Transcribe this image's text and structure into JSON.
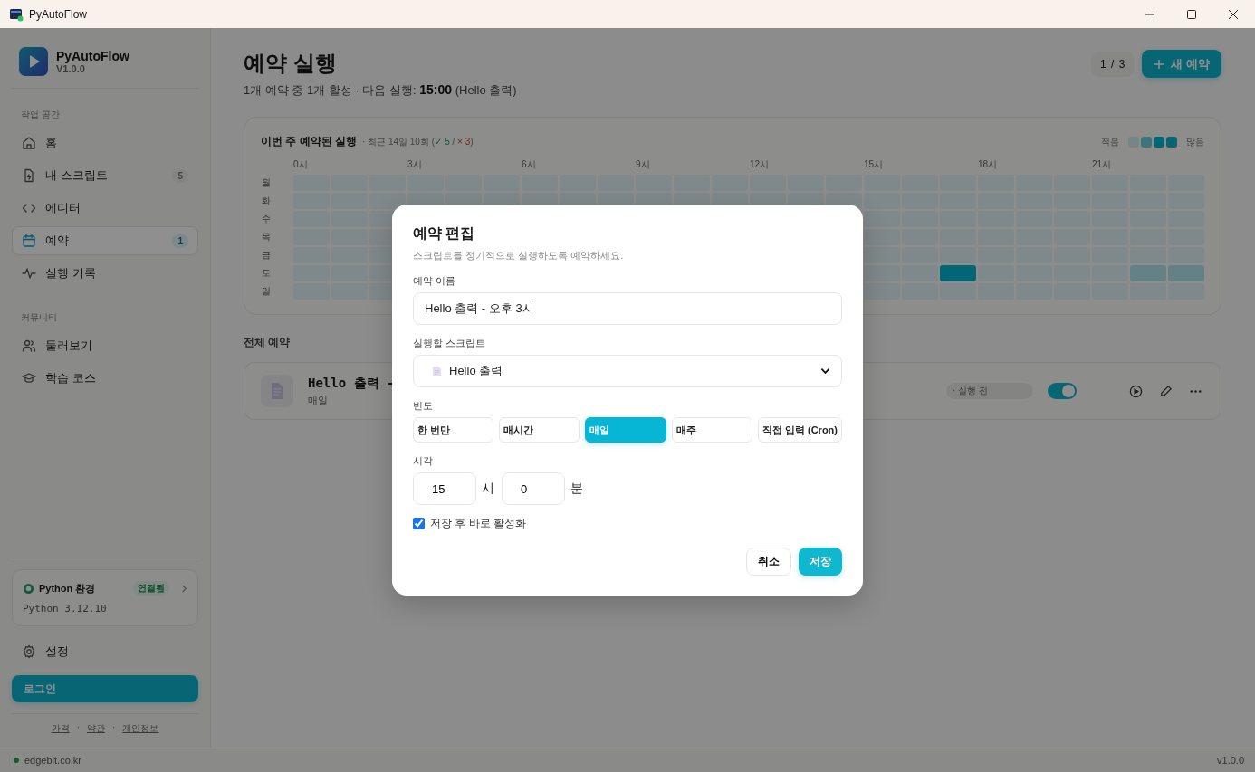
{
  "window": {
    "title": "PyAutoFlow"
  },
  "sidebar": {
    "app_name": "PyAutoFlow",
    "version": "V1.0.0",
    "sections": [
      {
        "title": "작업 공간",
        "items": [
          {
            "label": "홈",
            "selected": false
          },
          {
            "label": "내 스크립트",
            "badge": "5",
            "selected": false
          },
          {
            "label": "에디터",
            "selected": false
          },
          {
            "label": "예약",
            "badge": "1",
            "selected": true
          },
          {
            "label": "실행 기록",
            "selected": false
          }
        ]
      },
      {
        "title": "커뮤니티",
        "items": [
          {
            "label": "둘러보기",
            "selected": false
          },
          {
            "label": "학습 코스",
            "selected": false
          }
        ]
      }
    ],
    "python": {
      "title": "Python 환경",
      "status": "연결됨",
      "version": "Python 3.12.10"
    },
    "settings": "설정",
    "login": "로그인",
    "footer_links": {
      "separator": "·",
      "items": [
        "가격",
        "약관",
        "개인정보"
      ]
    }
  },
  "header": {
    "title": "예약 실행",
    "subtitle": "1개 예약 중 1개 활성 · 다음 실행: **15:00** (Hello 출력)",
    "pager": "1 / 3",
    "new_button": "새 예약"
  },
  "heatmap": {
    "title": "이번 주 예약된 실행",
    "summary": {
      "prefix": "· 최근 14일 10회 (",
      "success": "✓ 5",
      "separator": " / ",
      "failure": "× 3",
      "suffix": ")"
    },
    "legend": {
      "low": "적음",
      "high": "많음"
    },
    "hour_labels": [
      "0시",
      "3시",
      "6시",
      "9시",
      "12시",
      "15시",
      "18시",
      "21시"
    ],
    "rows": [
      {
        "day": "월",
        "cells": [
          {
            "kind": "none"
          },
          {
            "kind": "none"
          },
          {
            "kind": "none"
          },
          {
            "kind": "none"
          },
          {
            "kind": "none"
          },
          {
            "kind": "none"
          },
          {
            "kind": "none"
          },
          {
            "kind": "none"
          },
          {
            "kind": "none"
          },
          {
            "kind": "none"
          },
          {
            "kind": "none"
          },
          {
            "kind": "none"
          },
          {
            "kind": "none"
          },
          {
            "kind": "none"
          },
          {
            "kind": "none"
          },
          {
            "kind": "none"
          },
          {
            "kind": "none"
          },
          {
            "kind": "none"
          },
          {
            "kind": "none"
          },
          {
            "kind": "none"
          },
          {
            "kind": "none"
          },
          {
            "kind": "none"
          },
          {
            "kind": "none"
          },
          {
            "kind": "none"
          }
        ]
      },
      {
        "day": "화",
        "cells": [
          {
            "kind": "none"
          },
          {
            "kind": "none"
          },
          {
            "kind": "none"
          },
          {
            "kind": "none"
          },
          {
            "kind": "none"
          },
          {
            "kind": "none"
          },
          {
            "kind": "none"
          },
          {
            "kind": "none"
          },
          {
            "kind": "none"
          },
          {
            "kind": "none"
          },
          {
            "kind": "none"
          },
          {
            "kind": "none"
          },
          {
            "kind": "none"
          },
          {
            "kind": "none"
          },
          {
            "kind": "none"
          },
          {
            "kind": "none"
          },
          {
            "kind": "none"
          },
          {
            "kind": "none"
          },
          {
            "kind": "none"
          },
          {
            "kind": "none"
          },
          {
            "kind": "none"
          },
          {
            "kind": "none"
          },
          {
            "kind": "none"
          },
          {
            "kind": "none"
          }
        ]
      },
      {
        "day": "수",
        "cells": [
          {
            "kind": "none"
          },
          {
            "kind": "none"
          },
          {
            "kind": "none"
          },
          null,
          null,
          null,
          null,
          null,
          null,
          null,
          null,
          null,
          null,
          null,
          null,
          {
            "kind": "none"
          },
          {
            "kind": "none"
          },
          {
            "kind": "none"
          },
          {
            "kind": "none"
          },
          {
            "kind": "none"
          },
          {
            "kind": "none"
          },
          {
            "kind": "none"
          },
          {
            "kind": "none"
          },
          {
            "kind": "none"
          }
        ]
      },
      {
        "day": "목",
        "cells": [
          {
            "kind": "none"
          },
          {
            "kind": "none"
          },
          {
            "kind": "none"
          },
          null,
          null,
          null,
          null,
          null,
          null,
          null,
          null,
          null,
          null,
          null,
          null,
          {
            "kind": "none"
          },
          {
            "kind": "none"
          },
          {
            "kind": "none"
          },
          {
            "kind": "none"
          },
          {
            "kind": "none"
          },
          {
            "kind": "none"
          },
          {
            "kind": "none"
          },
          {
            "kind": "none"
          },
          {
            "kind": "none"
          }
        ]
      },
      {
        "day": "금",
        "cells": [
          {
            "kind": "none"
          },
          {
            "kind": "none"
          },
          {
            "kind": "none"
          },
          null,
          null,
          null,
          null,
          null,
          null,
          null,
          null,
          null,
          null,
          null,
          null,
          {
            "kind": "none"
          },
          {
            "kind": "none"
          },
          {
            "kind": "none"
          },
          {
            "kind": "none"
          },
          {
            "kind": "none"
          },
          {
            "kind": "none"
          },
          {
            "kind": "none"
          },
          {
            "kind": "none"
          },
          {
            "kind": "none"
          }
        ]
      },
      {
        "day": "토",
        "cells": [
          {
            "kind": "none"
          },
          {
            "kind": "none"
          },
          {
            "kind": "none"
          },
          null,
          null,
          null,
          null,
          null,
          null,
          null,
          null,
          null,
          null,
          null,
          null,
          {
            "kind": "none"
          },
          {
            "kind": "none"
          },
          {
            "kind": "high"
          },
          {
            "kind": "none"
          },
          {
            "kind": "none"
          },
          {
            "kind": "none"
          },
          {
            "kind": "none"
          },
          {
            "kind": "low"
          },
          {
            "kind": "low"
          }
        ]
      },
      {
        "day": "일",
        "cells": [
          {
            "kind": "none"
          },
          {
            "kind": "none"
          },
          {
            "kind": "none"
          },
          null,
          null,
          null,
          null,
          null,
          null,
          null,
          null,
          null,
          null,
          null,
          null,
          {
            "kind": "none"
          },
          {
            "kind": "none"
          },
          {
            "kind": "none"
          },
          {
            "kind": "none"
          },
          {
            "kind": "none"
          },
          {
            "kind": "none"
          },
          {
            "kind": "none"
          },
          {
            "kind": "none"
          },
          {
            "kind": "none"
          }
        ]
      }
    ]
  },
  "schedules": {
    "title": "전체 예약",
    "items": [
      {
        "name": "Hello 출력 -",
        "frequency": "매일",
        "status": "· 실행 전",
        "enabled": true
      }
    ]
  },
  "dialog": {
    "title": "예약 편집",
    "description": "스크립트를 정기적으로 실행하도록 예약하세요.",
    "name_label": "예약 이름",
    "name_value": "Hello 출력 - 오후 3시",
    "script_label": "실행할 스크립트",
    "script_value": "Hello 출력",
    "frequency_label": "빈도",
    "frequencies": [
      {
        "label": "한 번만",
        "selected": false
      },
      {
        "label": "매시간",
        "selected": false
      },
      {
        "label": "매일",
        "selected": true
      },
      {
        "label": "매주",
        "selected": false
      },
      {
        "label": "직접 입력 (Cron)",
        "selected": false
      }
    ],
    "time_label": "시각",
    "hour_value": "15",
    "hour_unit": "시",
    "minute_value": "0",
    "minute_unit": "분",
    "activate": {
      "label": "저장 후 바로 활성화",
      "checked": true
    },
    "cancel": "취소",
    "save": "저장"
  },
  "status_bar": {
    "host": "edgebit.co.kr",
    "version": "v1.0.0"
  }
}
